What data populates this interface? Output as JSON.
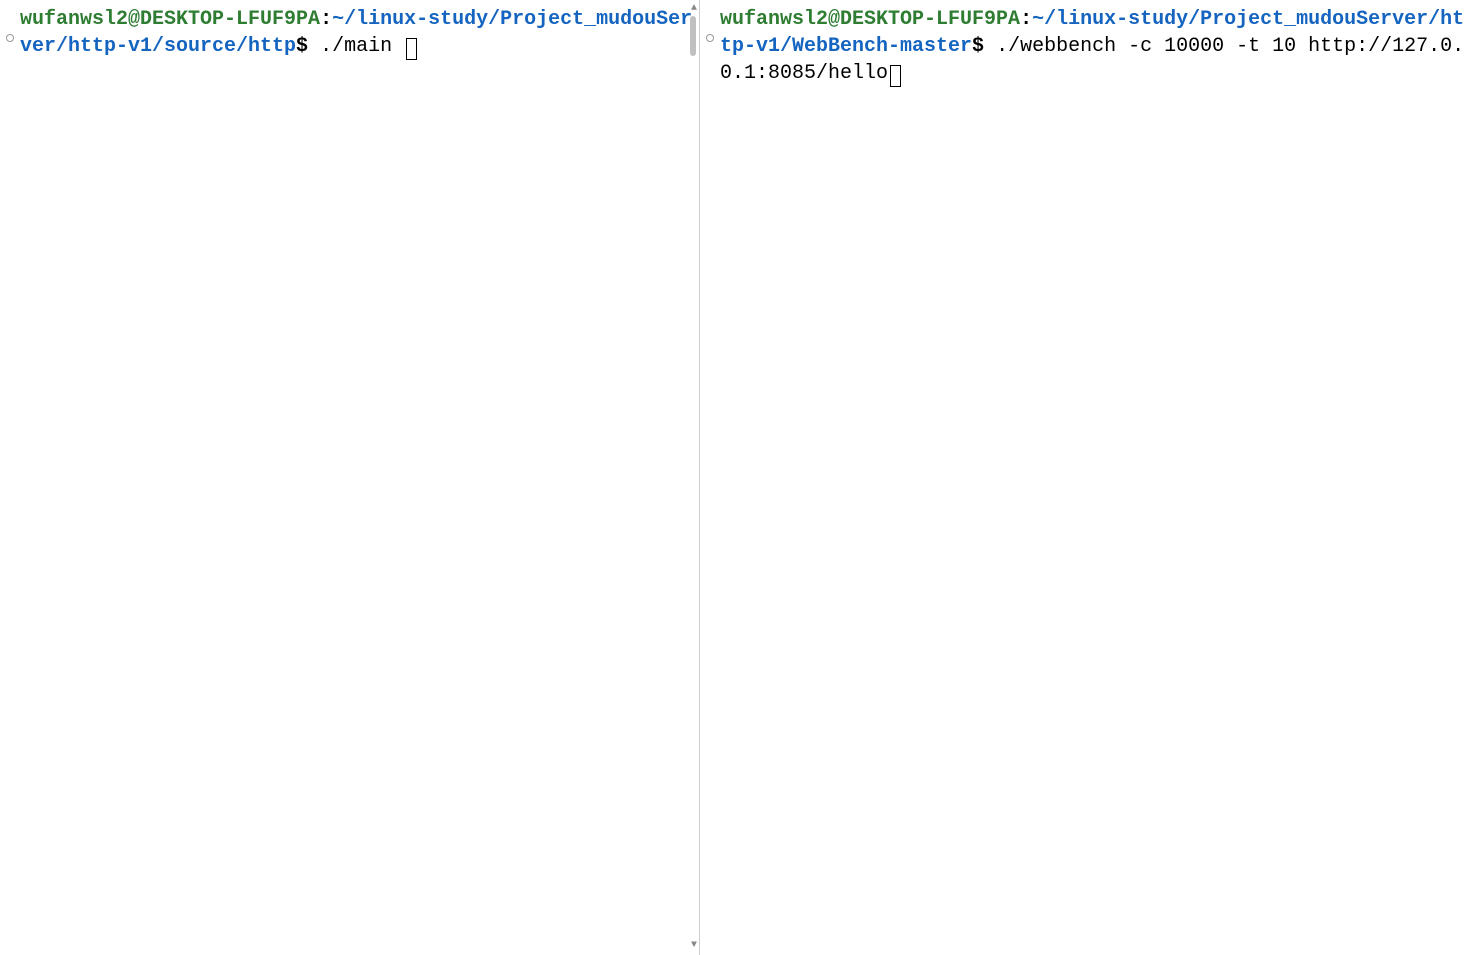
{
  "panes": {
    "left": {
      "userHost": "wufanwsl2@DESKTOP-LFUF9PA",
      "colon": ":",
      "path": "~/linux-study/Project_mudouServer/http-v1/source/http",
      "dollar": "$",
      "command": " ./main "
    },
    "right": {
      "userHost": "wufanwsl2@DESKTOP-LFUF9PA",
      "colon": ":",
      "path": "~/linux-study/Project_mudouServer/http-v1/WebBench-master",
      "dollar": "$",
      "command": " ./webbench -c 10000 -t 10 http://127.0.0.1:8085/hello"
    }
  }
}
